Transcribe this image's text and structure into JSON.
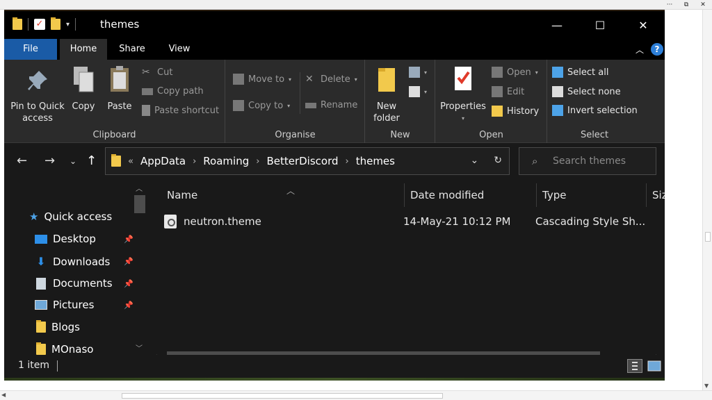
{
  "window": {
    "title": "themes"
  },
  "viewer": {
    "controls": [
      "···",
      "⧉",
      "✕"
    ]
  },
  "titlebar": {
    "minimize": "—",
    "maximize": "☐",
    "close": "✕",
    "qat_dropdown": "▾"
  },
  "tabs": {
    "file": "File",
    "home": "Home",
    "share": "Share",
    "view": "View"
  },
  "ribbon": {
    "clipboard": {
      "label": "Clipboard",
      "pin_line1": "Pin to Quick",
      "pin_line2": "access",
      "copy": "Copy",
      "paste": "Paste",
      "cut": "Cut",
      "copy_path": "Copy path",
      "paste_shortcut": "Paste shortcut"
    },
    "organise": {
      "label": "Organise",
      "move_to": "Move to",
      "copy_to": "Copy to",
      "delete": "Delete",
      "rename": "Rename"
    },
    "new": {
      "label": "New",
      "new_folder_line1": "New",
      "new_folder_line2": "folder"
    },
    "open": {
      "label": "Open",
      "properties": "Properties",
      "open": "Open",
      "edit": "Edit",
      "history": "History"
    },
    "select": {
      "label": "Select",
      "select_all": "Select all",
      "select_none": "Select none",
      "invert": "Invert selection"
    }
  },
  "address": {
    "prefix": "«",
    "crumbs": [
      "AppData",
      "Roaming",
      "BetterDiscord",
      "themes"
    ]
  },
  "search": {
    "placeholder": "Search themes"
  },
  "navpane": {
    "items": [
      {
        "label": "Quick access"
      },
      {
        "label": "Desktop"
      },
      {
        "label": "Downloads"
      },
      {
        "label": "Documents"
      },
      {
        "label": "Pictures"
      },
      {
        "label": "Blogs"
      },
      {
        "label": "MOnaso"
      }
    ]
  },
  "columns": {
    "name": "Name",
    "date": "Date modified",
    "type": "Type",
    "size": "Size"
  },
  "files": [
    {
      "name": "neutron.theme",
      "date": "14-May-21 10:12 PM",
      "type": "Cascading Style Sh..."
    }
  ],
  "status": {
    "count": "1 item"
  },
  "colors": {
    "file_tab": "#1a5ba6",
    "window_bg": "#191919",
    "ribbon_bg": "#2b2b2b",
    "folder": "#f2c94c",
    "accent_blue": "#2d7fd8"
  }
}
